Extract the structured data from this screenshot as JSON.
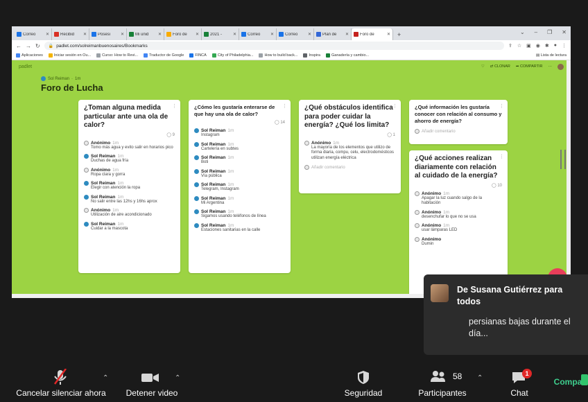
{
  "browser": {
    "tabs": [
      {
        "label": "Correo",
        "color": "#1a73e8"
      },
      {
        "label": "Recibid",
        "color": "#d93025"
      },
      {
        "label": "Posesi",
        "color": "#1a73e8"
      },
      {
        "label": "Mi unid",
        "color": "#188038"
      },
      {
        "label": "Foro de",
        "color": "#f9ab00"
      },
      {
        "label": "2021 -",
        "color": "#188038"
      },
      {
        "label": "Correo",
        "color": "#1a73e8"
      },
      {
        "label": "Correo",
        "color": "#1a73e8"
      },
      {
        "label": "Plan de",
        "color": "#3367d6"
      },
      {
        "label": "Foro de",
        "color": "#c5221f",
        "active": true
      }
    ],
    "new_tab": "+",
    "url": "padlet.com/solreimanbuenosaires/Bookmarks",
    "bookmarks": [
      {
        "label": "Aplicaciones",
        "color": "#4285f4"
      },
      {
        "label": "Iniciar sesión en Ou...",
        "color": "#f4b400"
      },
      {
        "label": "Curso: How to Revi...",
        "color": "#9aa0a6"
      },
      {
        "label": "Traductor de Google",
        "color": "#4285f4"
      },
      {
        "label": "FINCA",
        "color": "#1a73e8"
      },
      {
        "label": "City of Philadelphia...",
        "color": "#34a853"
      },
      {
        "label": "How to build back...",
        "color": "#9aa0a6"
      },
      {
        "label": "Inspira",
        "color": "#5f6368"
      },
      {
        "label": "Ganadería y cambio...",
        "color": "#188038"
      }
    ],
    "reading_list": "Lista de lectura"
  },
  "padlet": {
    "brand": "padlet",
    "actions": {
      "clone": "CLONAR",
      "share": "COMPARTIR"
    },
    "author": "Sol Reiman",
    "author_time": "1m",
    "title": "Foro de Lucha",
    "columns": [
      {
        "title": "¿Toman alguna medida particular ante una ola de calor?",
        "count": "9",
        "comments": [
          {
            "who": "Anónimo",
            "time": "1m",
            "text": "Tomo más agua y evito salir en horarios pico"
          },
          {
            "who": "Sol Reiman",
            "time": "1m",
            "text": "Duchas de agua fría"
          },
          {
            "who": "Anónimo",
            "time": "1m",
            "text": "Ropa clara y gorra"
          },
          {
            "who": "Sol Reiman",
            "time": "1m",
            "text": "Elegir con atención la ropa"
          },
          {
            "who": "Sol Reiman",
            "time": "1m",
            "text": "No salir entre las 12hs y 16hs aprox"
          },
          {
            "who": "Anónimo",
            "time": "1m",
            "text": "Utilización de aire acondicionado"
          },
          {
            "who": "Sol Reiman",
            "time": "1m",
            "text": "Cuidar a la mascota"
          }
        ]
      },
      {
        "title": "¿Cómo les gustaría enterarse de que hay una ola de calor?",
        "count": "14",
        "comments": [
          {
            "who": "Sol Reiman",
            "time": "1m",
            "text": "Instagram"
          },
          {
            "who": "Sol Reiman",
            "time": "1m",
            "text": "Cartelería en subtes"
          },
          {
            "who": "Sol Reiman",
            "time": "1m",
            "text": "Boti"
          },
          {
            "who": "Sol Reiman",
            "time": "1m",
            "text": "Vía pública"
          },
          {
            "who": "Sol Reiman",
            "time": "1m",
            "text": "Telegram, Instagram"
          },
          {
            "who": "Sol Reiman",
            "time": "1m",
            "text": "Mi Argentina"
          },
          {
            "who": "Sol Reiman",
            "time": "1m",
            "text": "Sigamos usando teléfonos de línea"
          },
          {
            "who": "Sol Reiman",
            "time": "1m",
            "text": "Estaciones sanitarias en la calle"
          }
        ]
      },
      {
        "title": "¿Qué obstáculos identifica para poder cuidar la energía? ¿Qué los limita?",
        "count": "1",
        "comments": [
          {
            "who": "Anónimo",
            "time": "1m",
            "text": "La mayoría de los elementos que utilizo de forma diaria, compu, celu, electrodomésticos utilizan energía eléctrica"
          }
        ],
        "add_comment": "Añadir comentario"
      },
      {
        "title": "¿Qué información les gustaría conocer con relación al consumo y ahorro de energía?",
        "add_comment": "Añadir comentario"
      },
      {
        "title": "¿Qué acciones realizan diariamente con relación al cuidado de la energía?",
        "count": "10",
        "comments": [
          {
            "who": "Anónimo",
            "time": "1m",
            "text": "Apagar la luz cuando salgo de la habitación"
          },
          {
            "who": "Anónimo",
            "time": "1m",
            "text": "desenchufar lo que no se usa"
          },
          {
            "who": "Anónimo",
            "time": "1m",
            "text": "usar lámparas LED"
          },
          {
            "who": "Anónimo",
            "time": "",
            "text": "Dumin"
          }
        ]
      }
    ]
  },
  "chat_popup": {
    "sender": "De Susana Gutiérrez para todos",
    "message": "persianas bajas durante el día..."
  },
  "toolbar": {
    "mute": "Cancelar silenciar ahora",
    "video": "Detener video",
    "security": "Seguridad",
    "participants": "Participantes",
    "participants_count": "58",
    "chat": "Chat",
    "chat_badge": "1",
    "share": "Compart"
  }
}
